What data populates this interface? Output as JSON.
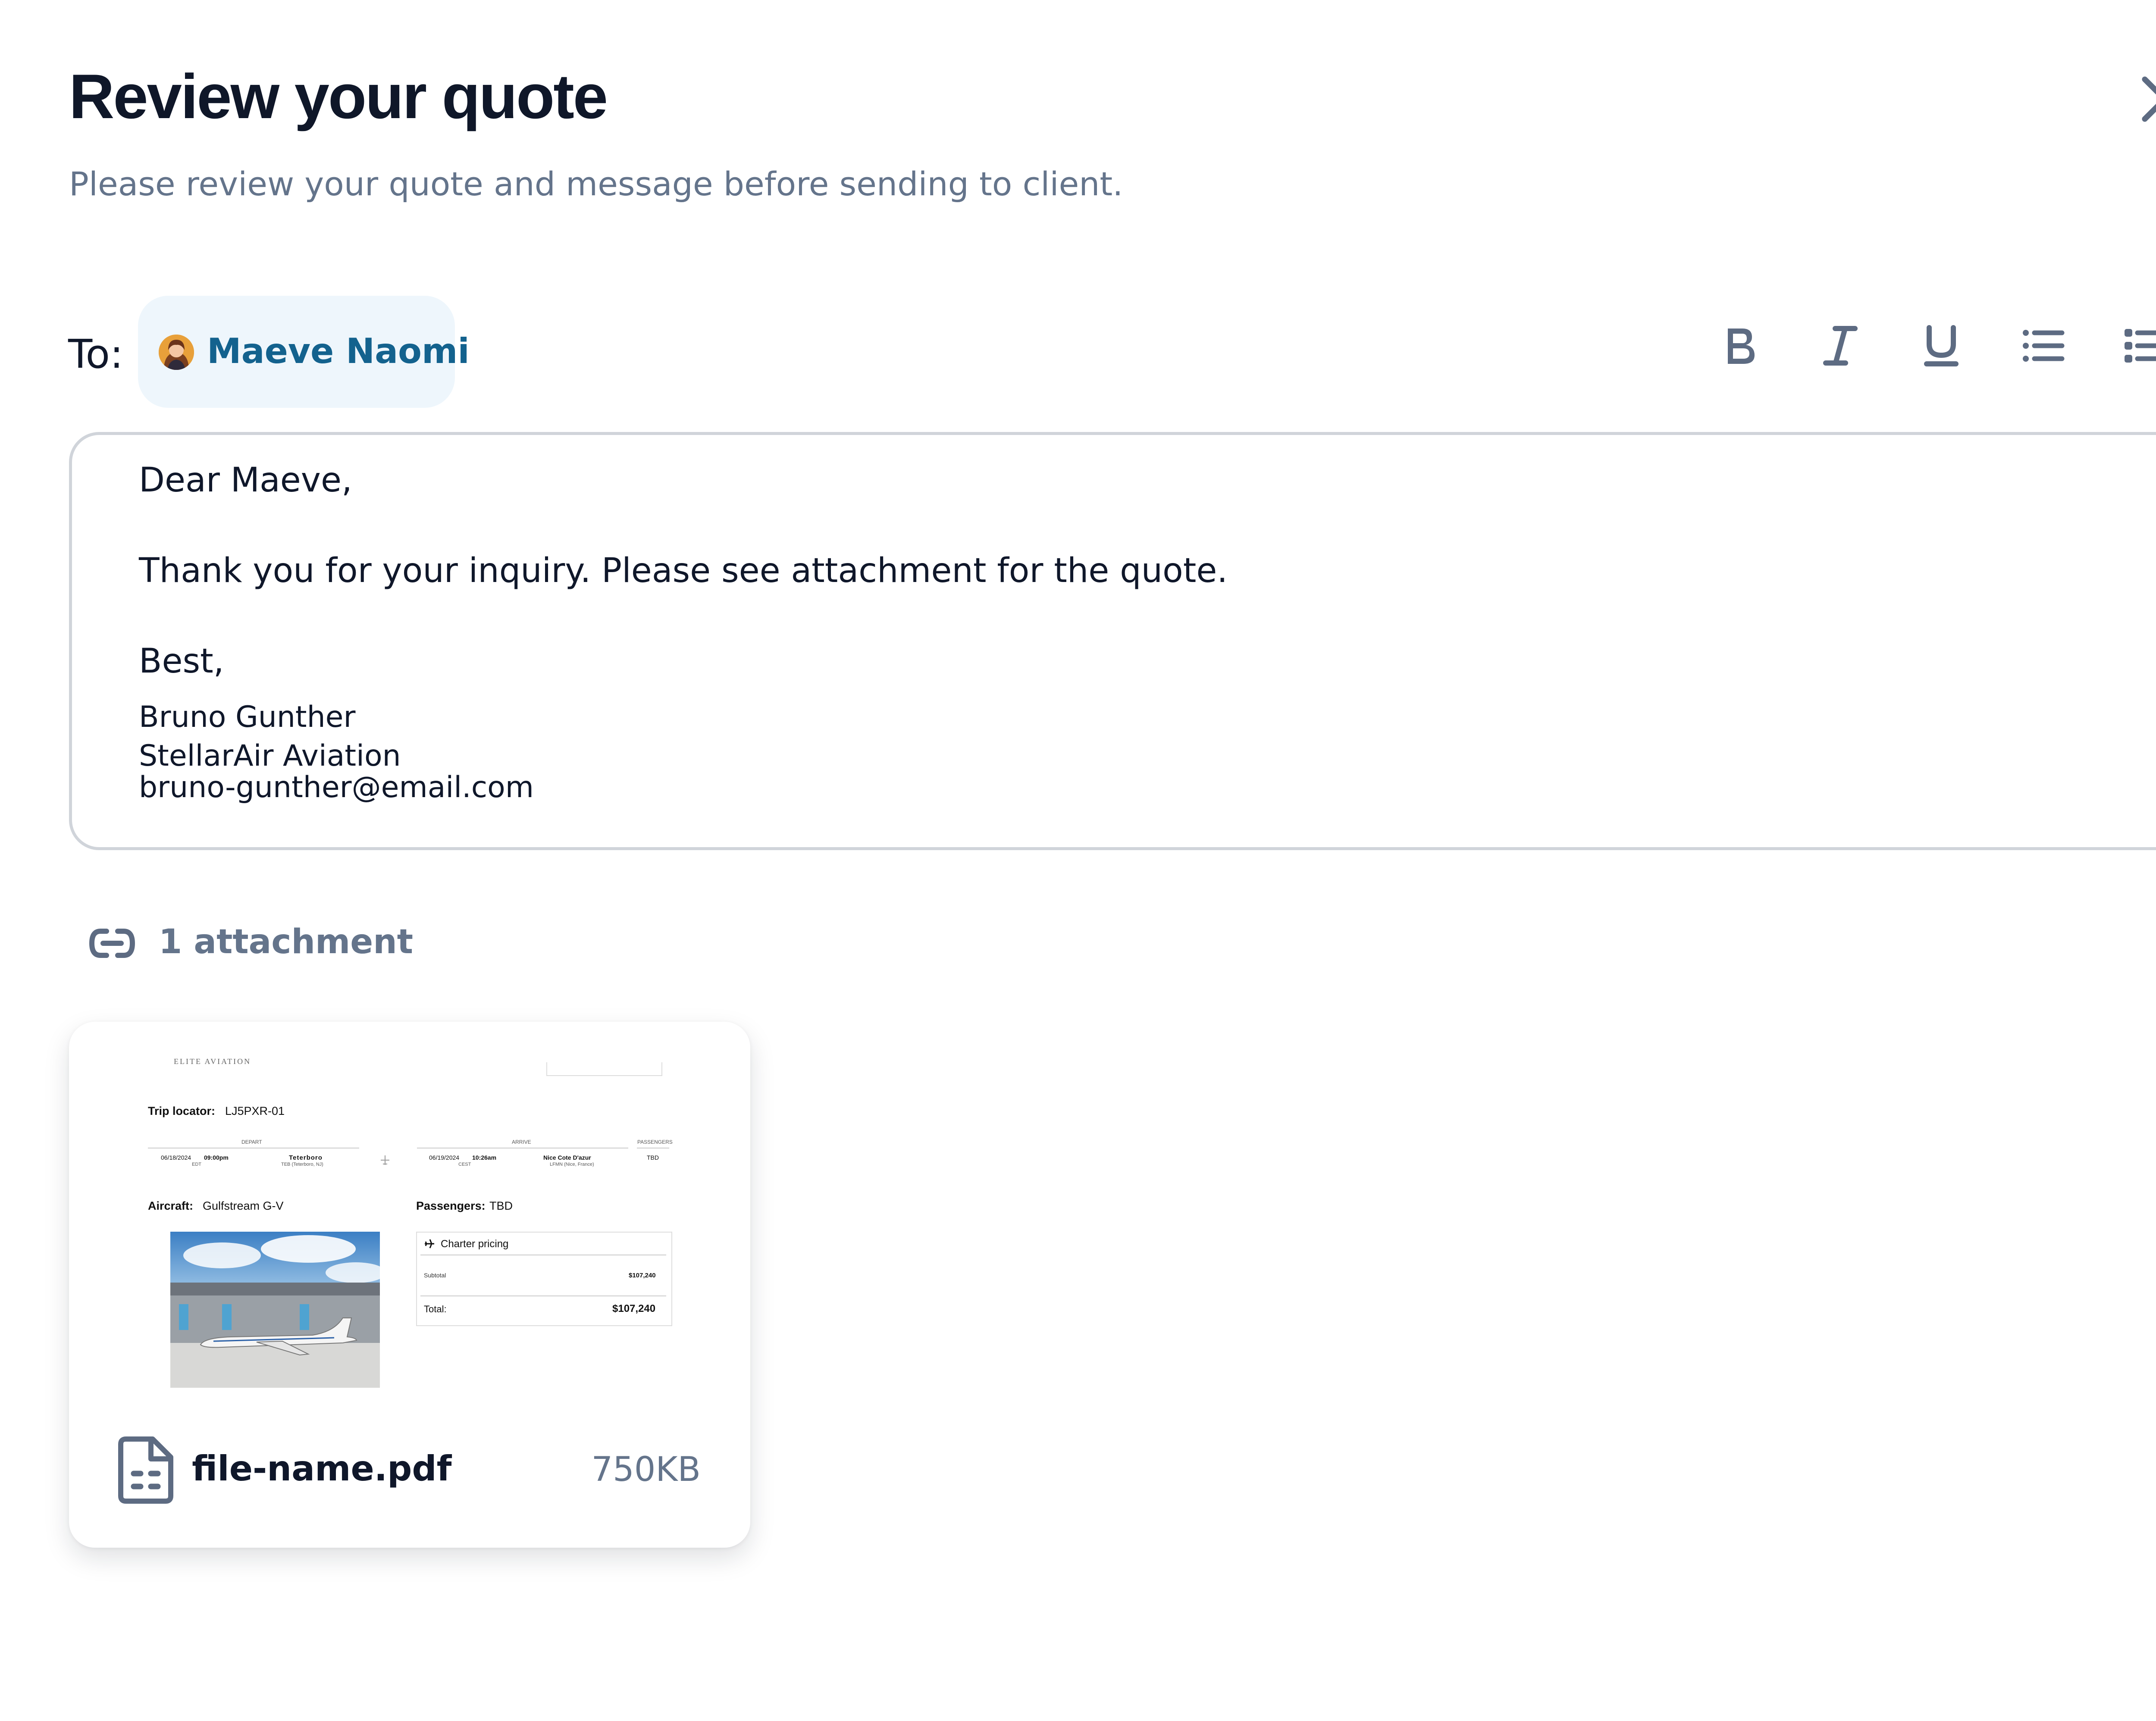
{
  "header": {
    "title": "Review your quote",
    "subtitle": "Please review your quote and message before sending to client.",
    "close_icon": "close-icon"
  },
  "recipient": {
    "to_label": "To:",
    "name": "Maeve Naomi",
    "avatar_icon": "user-avatar"
  },
  "toolbar": {
    "items": [
      {
        "name": "bold",
        "icon": "bold-icon"
      },
      {
        "name": "italic",
        "icon": "italic-icon"
      },
      {
        "name": "underline",
        "icon": "underline-icon"
      },
      {
        "name": "bulleted-list",
        "icon": "bulleted-list-icon"
      },
      {
        "name": "numbered-list",
        "icon": "numbered-list-icon"
      }
    ]
  },
  "message": {
    "greeting": "Dear Maeve,",
    "body": "Thank you for your inquiry. Please see attachment for the quote.",
    "closing": "Best,",
    "signature_name": "Bruno Gunther",
    "signature_company": "StellarAir Aviation",
    "signature_email": "bruno-gunther@email.com"
  },
  "attachments": {
    "count_label": "1 attachment",
    "link_icon": "link-icon",
    "file": {
      "name": "file-name.pdf",
      "size": "750KB",
      "file_icon": "document-icon",
      "preview": {
        "brand": "ELITE AVIATION",
        "trip_locator_label": "Trip locator:",
        "trip_locator": "LJ5PXR-01",
        "depart_header": "DEPART",
        "arrive_header": "ARRIVE",
        "passengers_header": "PASSENGERS",
        "depart_date": "06/18/2024",
        "depart_time": "09:00pm",
        "depart_tz": "EDT",
        "depart_airport": "Teterboro",
        "depart_airport_detail": "TEB (Teterboro, NJ)",
        "arrive_date": "06/19/2024",
        "arrive_time": "10:26am",
        "arrive_tz": "CEST",
        "arrive_airport": "Nice Cote D'azur",
        "arrive_airport_detail": "LFMN (Nice, France)",
        "passengers_value": "TBD",
        "aircraft_label": "Aircraft:",
        "aircraft": "Gulfstream G-V",
        "passengers_label": "Passengers:",
        "passengers": "TBD",
        "pricing_title": "Charter pricing",
        "subtotal_label": "Subtotal",
        "subtotal": "$107,240",
        "total_label": "Total:",
        "total": "$107,240"
      }
    }
  },
  "colors": {
    "title": "#0f1729",
    "muted": "#64748b",
    "chip_bg": "#eef6fc",
    "chip_text": "#13628e",
    "border": "#d0d4da",
    "icon": "#5d6b82"
  }
}
